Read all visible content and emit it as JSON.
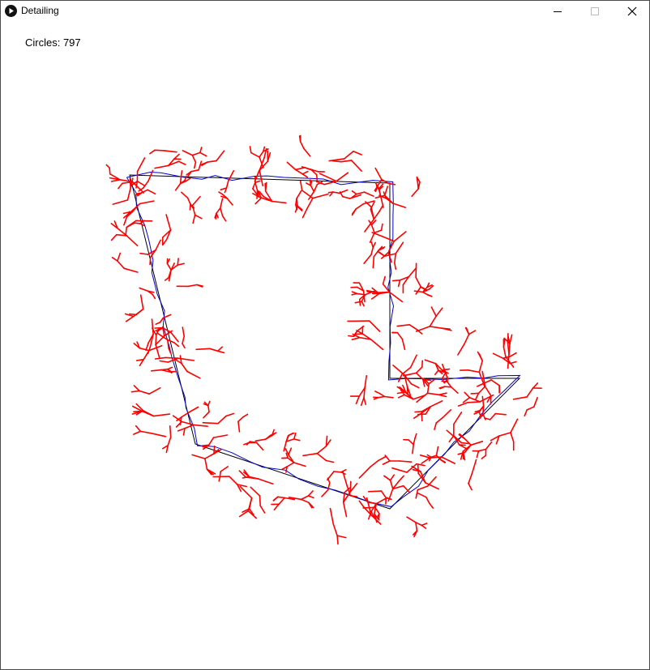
{
  "window": {
    "title": "Detailing",
    "icon": "play-icon"
  },
  "controls": {
    "minimize_icon": "minimize-icon",
    "maximize_icon": "maximize-icon",
    "close_icon": "close-icon"
  },
  "sketch": {
    "circles_label": "Circles: 797"
  },
  "colors": {
    "outline": "#000000",
    "path": "#0000cc",
    "branches": "#ff0000"
  }
}
